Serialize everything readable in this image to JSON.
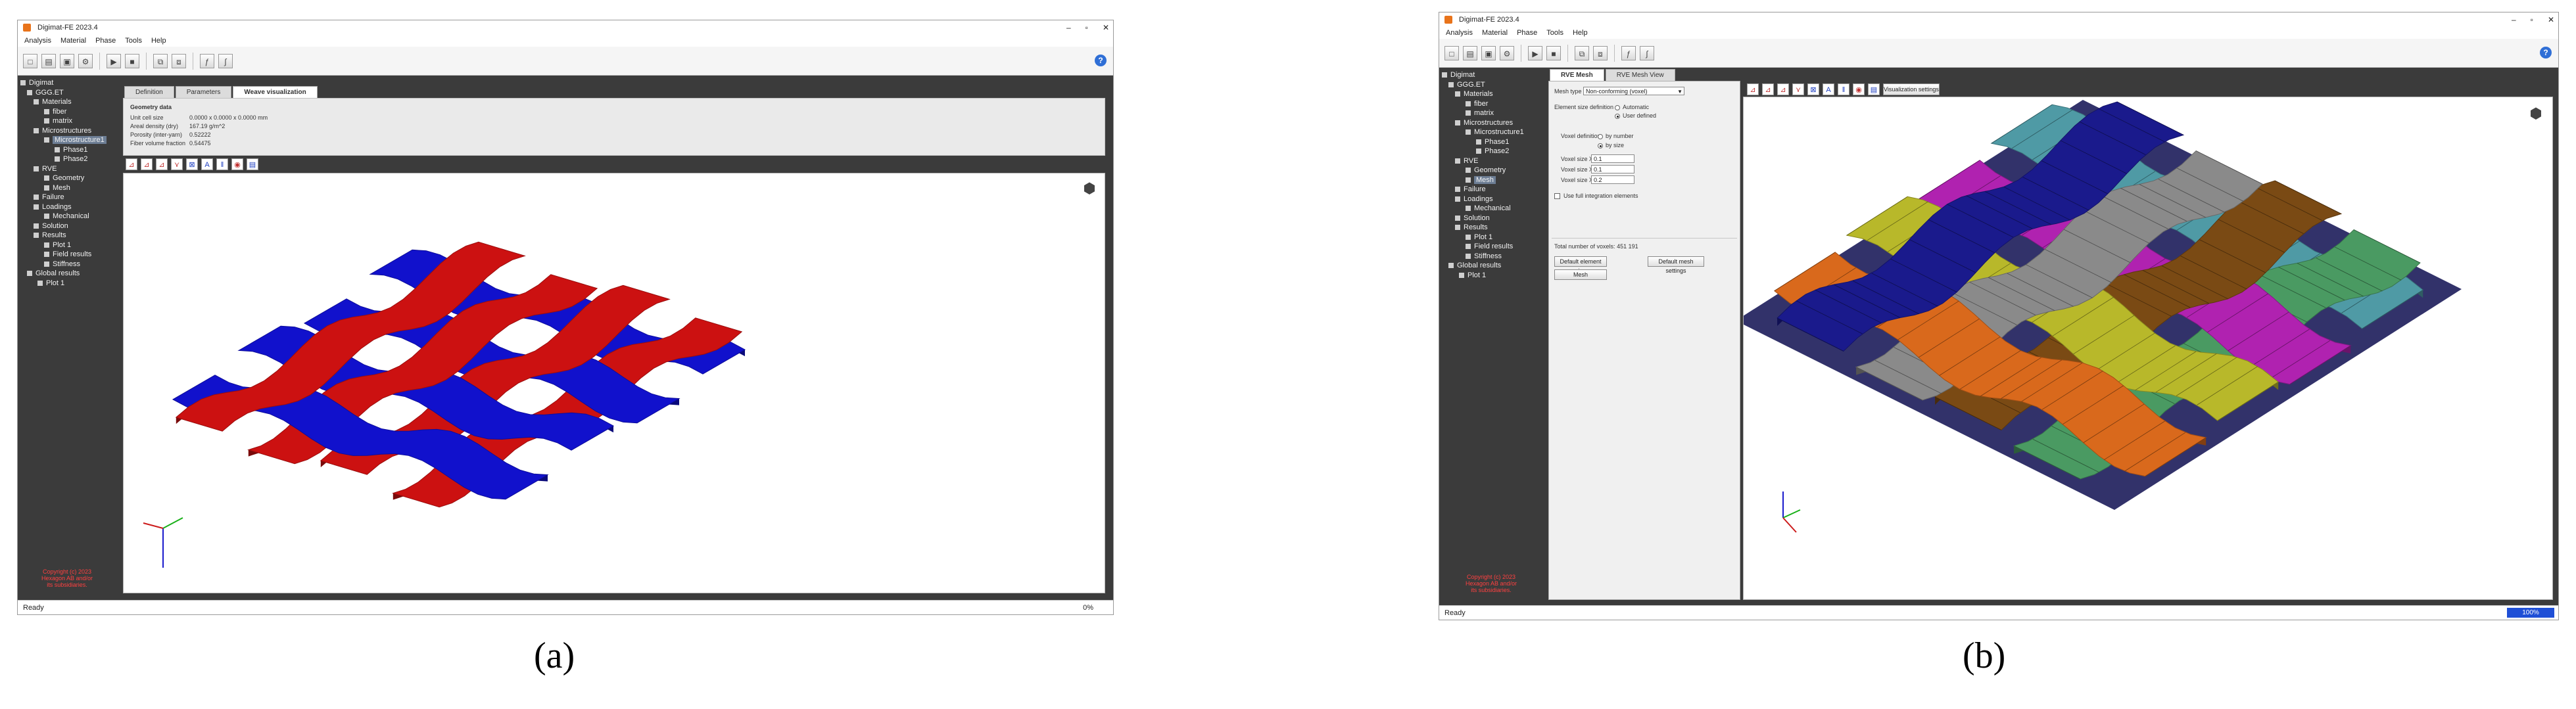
{
  "window": {
    "title": "Digimat-FE 2023.4",
    "controls": [
      "–",
      "▫",
      "✕"
    ],
    "menu": [
      "Analysis",
      "Material",
      "Phase",
      "Tools",
      "Help"
    ],
    "status_text": "Ready",
    "help_icon": "question-mark-icon"
  },
  "tree": {
    "items": [
      {
        "label": "Digimat",
        "icon": "digimat-icon"
      },
      {
        "label": "GGG.ET",
        "icon": "analysis-icon"
      },
      {
        "label": "Materials",
        "icon": "materials-icon"
      },
      {
        "label": "fiber",
        "icon": "material-icon"
      },
      {
        "label": "matrix",
        "icon": "material-icon"
      },
      {
        "label": "Microstructures",
        "icon": "microstructures-icon"
      },
      {
        "label": "Microstructure1",
        "icon": "microstructure-icon"
      },
      {
        "label": "Phase1",
        "icon": "phase-icon"
      },
      {
        "label": "Phase2",
        "icon": "phase-icon"
      },
      {
        "label": "RVE",
        "icon": "rve-icon"
      },
      {
        "label": "Geometry",
        "icon": "geometry-icon"
      },
      {
        "label": "Mesh",
        "icon": "mesh-icon"
      },
      {
        "label": "Failure",
        "icon": "failure-icon"
      },
      {
        "label": "Loadings",
        "icon": "loadings-icon"
      },
      {
        "label": "Mechanical",
        "icon": "mechanical-icon"
      },
      {
        "label": "Solution",
        "icon": "solution-icon"
      },
      {
        "label": "Results",
        "icon": "results-icon"
      },
      {
        "label": "Plot 1",
        "icon": "plot-icon"
      },
      {
        "label": "Field results",
        "icon": "field-results-icon"
      },
      {
        "label": "Stiffness",
        "icon": "stiffness-icon"
      },
      {
        "label": "Global results",
        "icon": "global-results-icon"
      },
      {
        "label": "Plot 1",
        "icon": "plot-icon"
      }
    ],
    "selected_a": "Microstructure1",
    "selected_b": "Mesh",
    "copyright": [
      "Copyright (c) 2023",
      "Hexagon AB and/or",
      "its subsidiaries."
    ]
  },
  "panel_a": {
    "tabs": [
      "Definition",
      "Parameters",
      "Weave visualization"
    ],
    "active_tab": "Weave visualization",
    "info_title": "Geometry data",
    "info_rows": [
      [
        "Unit cell size",
        "0.0000 x 0.0000 x 0.0000 mm"
      ],
      [
        "Areal density (dry)",
        "167.19 g/m^2"
      ],
      [
        "Porosity (inter-yarn)",
        "0.52222"
      ],
      [
        "Fiber volume fraction",
        "0.54475"
      ]
    ],
    "status_right": "0%",
    "weave_colors": {
      "warp": "#cc1111",
      "weft": "#1111cc"
    }
  },
  "panel_b": {
    "tabs": [
      "RVE Mesh",
      "RVE Mesh View"
    ],
    "active_tab": "RVE Mesh",
    "mesh_type_label": "Mesh type",
    "mesh_type_value": "Non-conforming (voxel)",
    "element_size_label": "Element size definition",
    "element_size_options": [
      "Automatic",
      "User defined"
    ],
    "element_size_selected": "User defined",
    "voxel_def_label": "Voxel definition",
    "voxel_def_options": [
      "by number",
      "by size"
    ],
    "voxel_def_selected": "by size",
    "voxel_fields": [
      {
        "label": "Voxel size X1",
        "value": "0.1"
      },
      {
        "label": "Voxel size X2",
        "value": "0.1"
      },
      {
        "label": "Voxel size X3",
        "value": "0.2"
      }
    ],
    "reduced_integration_label": "Use full integration elements",
    "total_voxels_label": "Total number of voxels",
    "total_voxels_value": "451 191",
    "default_element_size_button": "Default element size",
    "default_mesh_settings_button": "Default mesh settings",
    "mesh_button": "Mesh",
    "visualization_settings_button": "Visualization settings",
    "progress": "100%",
    "yarn_colors": [
      "#d9691c",
      "#1a1a8c",
      "#b8b82a",
      "#8a8a8a",
      "#b022b0",
      "#7a4a14",
      "#4f9aa5",
      "#4a9a62",
      "#a8a8a8"
    ]
  },
  "captions": {
    "a": "(a)",
    "b": "(b)"
  }
}
